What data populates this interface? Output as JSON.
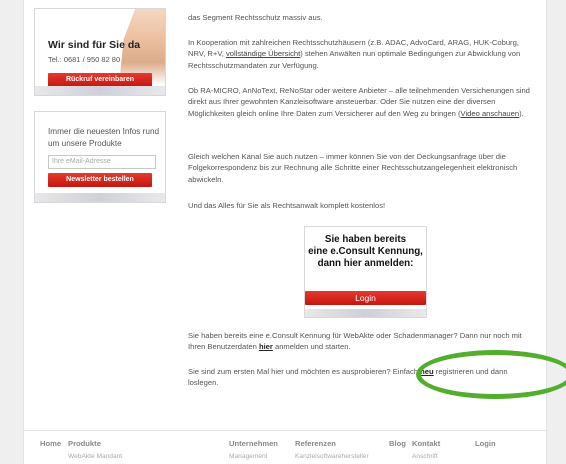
{
  "sidebar": {
    "contact": {
      "title": "Wir sind für Sie da",
      "phone": "Tel.: 0681 / 950 82 80",
      "callback_button": "Rückruf vereinbaren"
    },
    "newsletter": {
      "text": "Immer die neuesten Infos rund um unsere Produkte",
      "email_placeholder": "Ihre eMail-Adresse",
      "subscribe_button": "Newsletter bestellen"
    }
  },
  "content": {
    "p0": "das Segment Rechtsschutz massiv aus.",
    "p1_before": "In Kooperation mit zahlreichen Rechtsschutzhäusern (z.B. ADAC, AdvoCard, ARAG, HUK-Coburg, NRV, R+V, ",
    "p1_link": "vollständige Übersicht",
    "p1_after": ") stehen Anwälten nun optimale Bedingungen zur Abwicklung von Rechtsschutzmandaten zur Verfügung.",
    "p2_before": "Ob RA-MICRO, AnNoText, ReNoStar oder weitere Anbieter – alle teilnehmenden Versicherungen sind direkt aus Ihrer gewohnten Kanzleisoftware ansteuerbar. Oder Sie nutzen eine der diversen Möglichkeiten gleich online Ihre Daten zum Versicherer auf den Weg zu bringen (",
    "p2_link": "Video anschauen",
    "p2_after": ").",
    "p3": "Gleich welchen Kanal Sie auch nutzen – immer können Sie von der Deckungsanfrage über die Folgekorrespondenz bis zur Rechnung alle Schritte einer Rechtsschutzangelegenheit elektronisch abwickeln.",
    "p4": "Und das Alles für Sie als Rechtsanwalt komplett kostenlos!",
    "p5_before": "Sie haben bereits eine e.Consult Kennung für WebAkte oder Schadenmanager? Dann nur noch mit Ihren Benutzerdaten ",
    "p5_link": "hier",
    "p5_after": " anmelden und starten.",
    "p6_before": "Sie sind zum ersten Mal hier und möchten es ausprobieren? Einfach ",
    "p6_link": "neu",
    "p6_after": " registrieren und dann loslegen."
  },
  "login_box": {
    "line1": "Sie haben bereits",
    "line2": "eine e.Consult Kennung,",
    "line3": "dann hier anmelden:",
    "button": "Login"
  },
  "footer": {
    "home": "Home",
    "produkte": "Produkte",
    "produkte_sub": "WebAkte Mandant",
    "unternehmen": "Unternehmen",
    "unternehmen_sub": "Management",
    "referenzen": "Referenzen",
    "referenzen_sub": "Kanzleisoftwarehersteller",
    "blog": "Blog",
    "kontakt": "Kontakt",
    "kontakt_sub": "Anschrift",
    "login": "Login"
  },
  "colors": {
    "accent_red": "#d4211a",
    "annotation_green": "#52ae2c"
  }
}
